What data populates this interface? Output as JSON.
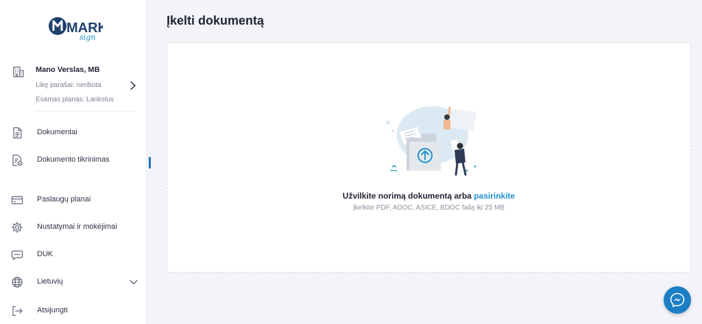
{
  "brand": {
    "logo_text": "MARK",
    "logo_script": "sign"
  },
  "account": {
    "name": "Mano Verslas, MB",
    "signatures_left": "Likę parašai: neribota",
    "current_plan": "Esamas planas: Lankstus"
  },
  "nav": {
    "documents": "Dokumentai",
    "verification": "Dokumento tikrinimas",
    "plans": "Paslaugų planai",
    "settings": "Nustatymai ir mokėjimai",
    "faq": "DUK",
    "language": "Lietuvių",
    "logout": "Atsijungti"
  },
  "main": {
    "title": "Įkelti dokumentą",
    "drop_text": "Užvilkite norimą dokumentą arba",
    "select_link": "pasirinkite",
    "hint": "Įkelkite PDF, ADOC, ASICE, BDOC failą iki 25 MB"
  },
  "colors": {
    "accent": "#1e8fd0",
    "brand": "#1d3f6e",
    "active": "#1f73b7"
  },
  "icons": {
    "account": "building-icon",
    "documents": "document-icon",
    "verification": "document-check-icon",
    "plans": "credit-card-icon",
    "settings": "gear-icon",
    "faq": "chat-icon",
    "language": "globe-icon",
    "logout": "logout-icon",
    "chat": "messenger-icon"
  }
}
